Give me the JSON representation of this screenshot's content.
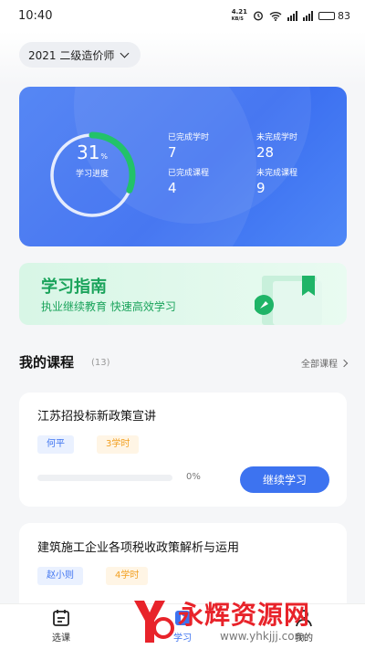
{
  "status_bar": {
    "time": "10:40",
    "network_speed": "4.21",
    "network_unit": "KB/S",
    "battery": "83"
  },
  "header": {
    "year_select": "2021 二级造价师"
  },
  "progress": {
    "percent": 31,
    "percent_text": "31",
    "percent_sign": "%",
    "label": "学习进度",
    "stats": [
      {
        "label": "已完成学时",
        "value": "7"
      },
      {
        "label": "未完成学时",
        "value": "28"
      },
      {
        "label": "已完成课程",
        "value": "4"
      },
      {
        "label": "未完成课程",
        "value": "9"
      }
    ],
    "colors": {
      "card": "#3d73f0",
      "ring_track": "#ffffff",
      "ring_progress": "#22c26a"
    }
  },
  "guide": {
    "title": "学习指南",
    "subtitle": "执业继续教育  快速高效学习",
    "color": "#1aa35b"
  },
  "courses_section": {
    "title": "我的课程",
    "count": "(13)",
    "all_link": "全部课程"
  },
  "courses": [
    {
      "title": "江苏招投标新政策宣讲",
      "teacher": "何平",
      "hours": "3学时",
      "progress": 0,
      "progress_text": "0%",
      "action": "继续学习"
    },
    {
      "title": "建筑施工企业各项税收政策解析与运用",
      "teacher": "赵小则",
      "hours": "4学时"
    }
  ],
  "tabbar": {
    "items": [
      {
        "label": "选课",
        "icon": "calendar-icon"
      },
      {
        "label": "学习",
        "icon": "play-book-icon",
        "active": true
      },
      {
        "label": "我的",
        "icon": "person-icon"
      }
    ],
    "active_color": "#3d73f0"
  },
  "watermark": {
    "text": "永辉资源网",
    "url": "www.yhkjjj.com"
  }
}
